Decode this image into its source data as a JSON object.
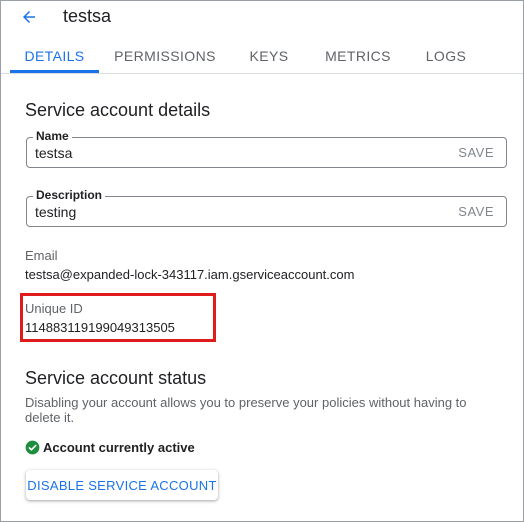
{
  "header": {
    "title": "testsa",
    "back_icon": "arrow-back-icon"
  },
  "tabs": [
    {
      "label": "DETAILS",
      "active": true
    },
    {
      "label": "PERMISSIONS",
      "active": false
    },
    {
      "label": "KEYS",
      "active": false
    },
    {
      "label": "METRICS",
      "active": false
    },
    {
      "label": "LOGS",
      "active": false
    }
  ],
  "details": {
    "section_title": "Service account details",
    "name": {
      "label": "Name",
      "value": "testsa",
      "save_label": "SAVE"
    },
    "description": {
      "label": "Description",
      "value": "testing",
      "save_label": "SAVE"
    },
    "email": {
      "label": "Email",
      "value": "testsa@expanded-lock-343117.iam.gserviceaccount.com"
    },
    "unique_id": {
      "label": "Unique ID",
      "value": "114883119199049313505"
    }
  },
  "status": {
    "section_title": "Service account status",
    "description": "Disabling your account allows you to preserve your policies without having to delete it.",
    "status_icon": "check-circle-icon",
    "status_text": "Account currently active",
    "disable_button_label": "DISABLE SERVICE ACCOUNT"
  },
  "colors": {
    "accent": "#1a73e8",
    "highlight": "#e01b1b",
    "success": "#1e8e3e"
  }
}
